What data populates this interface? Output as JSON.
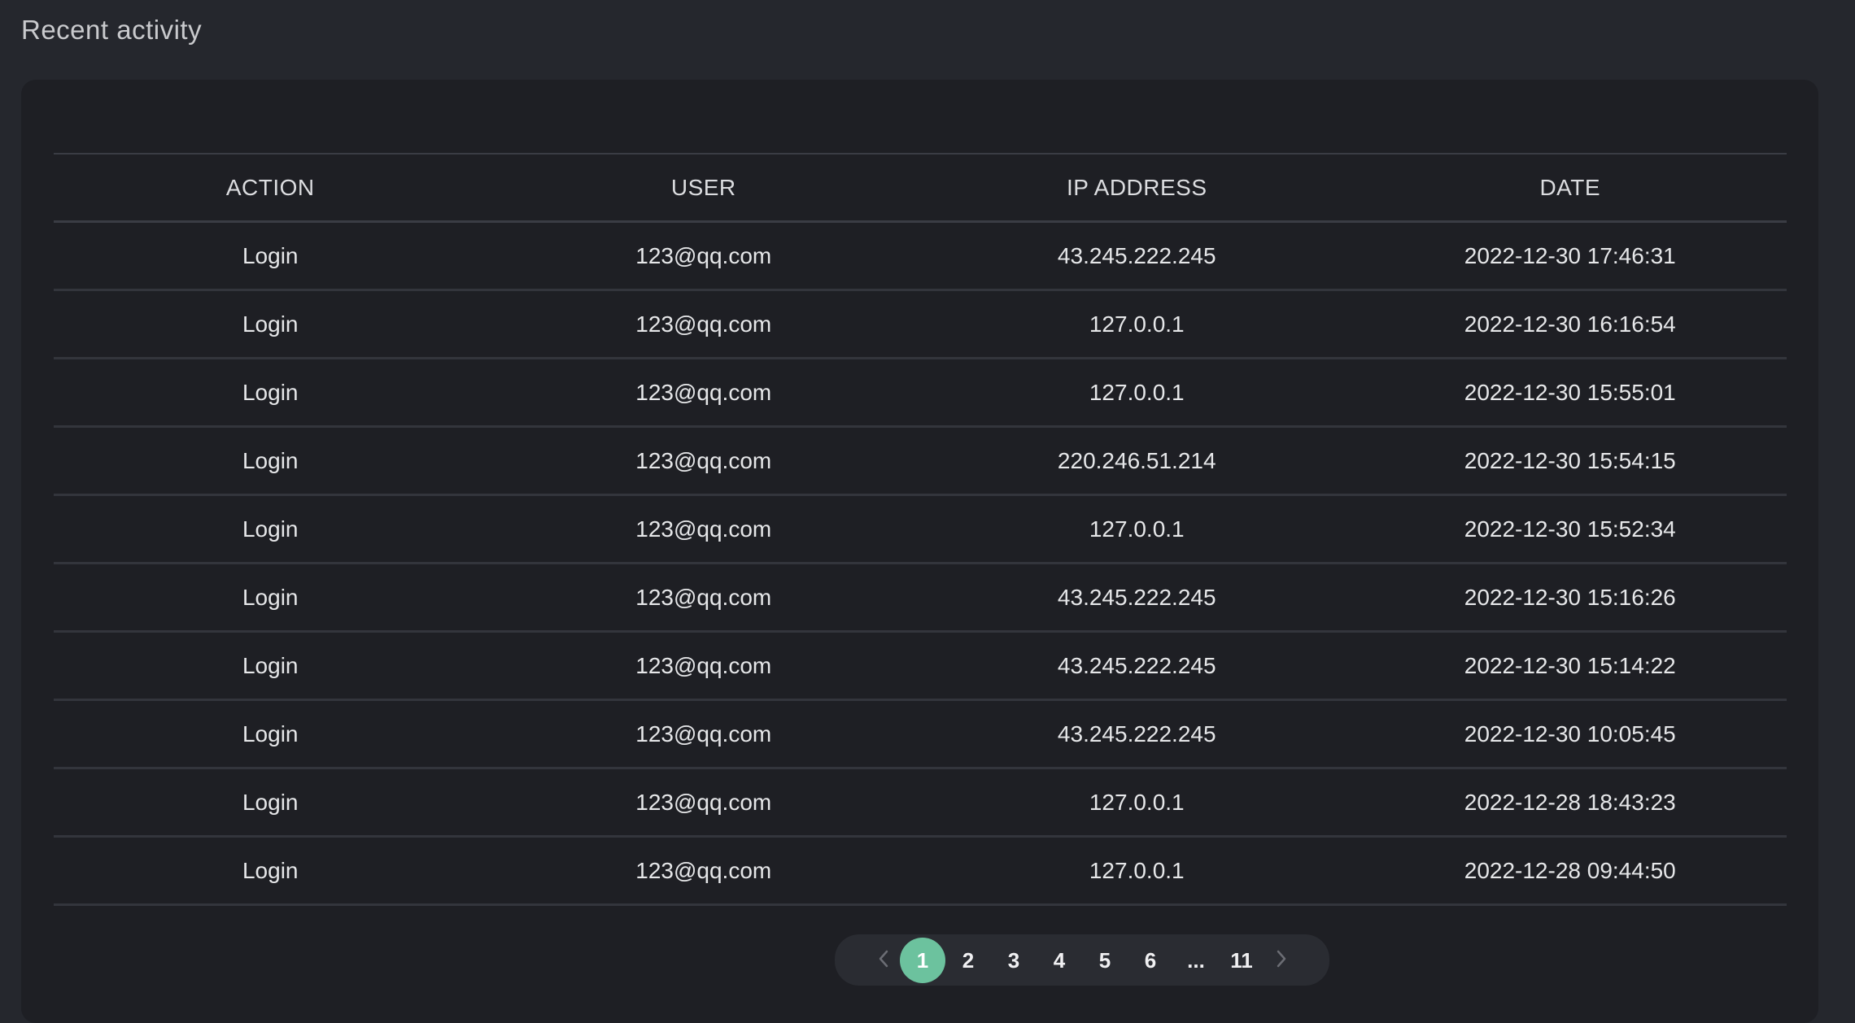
{
  "section": {
    "title": "Recent activity"
  },
  "table": {
    "columns": [
      "ACTION",
      "USER",
      "IP ADDRESS",
      "DATE"
    ],
    "rows": [
      [
        "Login",
        "123@qq.com",
        "43.245.222.245",
        "2022-12-30 17:46:31"
      ],
      [
        "Login",
        "123@qq.com",
        "127.0.0.1",
        "2022-12-30 16:16:54"
      ],
      [
        "Login",
        "123@qq.com",
        "127.0.0.1",
        "2022-12-30 15:55:01"
      ],
      [
        "Login",
        "123@qq.com",
        "220.246.51.214",
        "2022-12-30 15:54:15"
      ],
      [
        "Login",
        "123@qq.com",
        "127.0.0.1",
        "2022-12-30 15:52:34"
      ],
      [
        "Login",
        "123@qq.com",
        "43.245.222.245",
        "2022-12-30 15:16:26"
      ],
      [
        "Login",
        "123@qq.com",
        "43.245.222.245",
        "2022-12-30 15:14:22"
      ],
      [
        "Login",
        "123@qq.com",
        "43.245.222.245",
        "2022-12-30 10:05:45"
      ],
      [
        "Login",
        "123@qq.com",
        "127.0.0.1",
        "2022-12-28 18:43:23"
      ],
      [
        "Login",
        "123@qq.com",
        "127.0.0.1",
        "2022-12-28 09:44:50"
      ]
    ]
  },
  "pagination": {
    "prev_icon": "chevron-left-icon",
    "next_icon": "chevron-right-icon",
    "pages": [
      "1",
      "2",
      "3",
      "4",
      "5",
      "6",
      "...",
      "11"
    ],
    "current": "1",
    "active_color": "#6cc29e"
  }
}
